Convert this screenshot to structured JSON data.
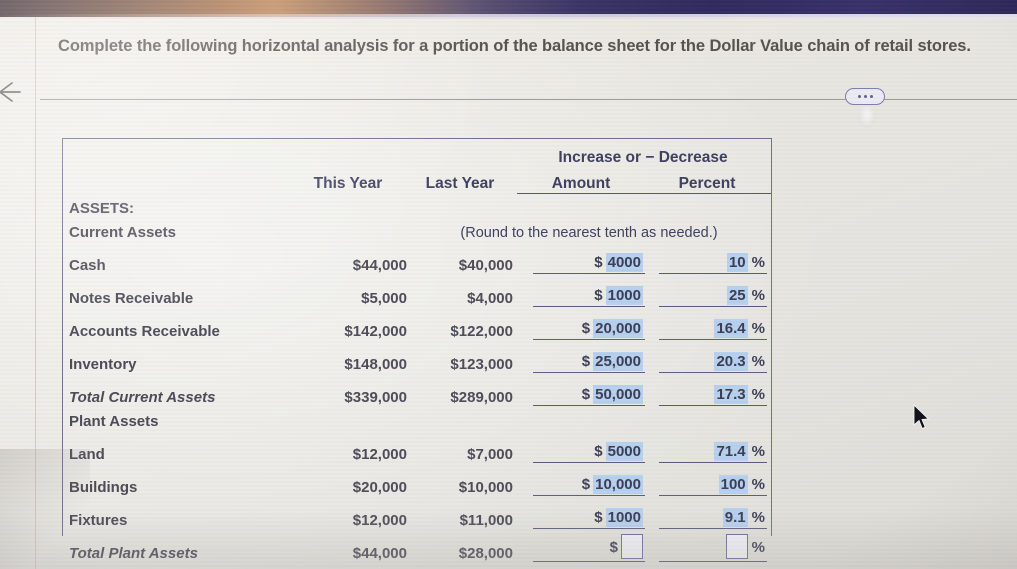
{
  "topbar": {
    "label": "browser-chrome-gradient-bar"
  },
  "nav": {
    "back_icon": "back-arrow-icon"
  },
  "prompt": {
    "text": "Complete the following horizontal analysis for a portion of the balance sheet for the Dollar Value chain of retail stores."
  },
  "divider": {
    "more_button_label": "more-options-ellipsis"
  },
  "worksheet": {
    "header": {
      "group_title": "Increase or − Decrease",
      "col_this_year": "This Year",
      "col_last_year": "Last Year",
      "col_amount": "Amount",
      "col_percent": "Percent"
    },
    "section_assets": "ASSETS:",
    "section_current_assets": "Current Assets",
    "section_plant_assets": "Plant Assets",
    "rounding_note": "(Round to the nearest tenth as needed.)",
    "rows": [
      {
        "label": "Cash",
        "this_year": "$44,000",
        "last_year": "$40,000",
        "amount_prefix": "$",
        "amount_value": "4000",
        "amount_filled": true,
        "percent_value": "10",
        "percent_suffix": "%",
        "percent_filled": true,
        "italic": false
      },
      {
        "label": "Notes Receivable",
        "this_year": "$5,000",
        "last_year": "$4,000",
        "amount_prefix": "$",
        "amount_value": "1000",
        "amount_filled": true,
        "percent_value": "25",
        "percent_suffix": "%",
        "percent_filled": true,
        "italic": false
      },
      {
        "label": "Accounts Receivable",
        "this_year": "$142,000",
        "last_year": "$122,000",
        "amount_prefix": "$",
        "amount_value": "20,000",
        "amount_filled": true,
        "percent_value": "16.4",
        "percent_suffix": "%",
        "percent_filled": true,
        "italic": false
      },
      {
        "label": "Inventory",
        "this_year": "$148,000",
        "last_year": "$123,000",
        "amount_prefix": "$",
        "amount_value": "25,000",
        "amount_filled": true,
        "percent_value": "20.3",
        "percent_suffix": "%",
        "percent_filled": true,
        "italic": false
      },
      {
        "label": "Total Current Assets",
        "this_year": "$339,000",
        "last_year": "$289,000",
        "amount_prefix": "$",
        "amount_value": "50,000",
        "amount_filled": true,
        "percent_value": "17.3",
        "percent_suffix": "%",
        "percent_filled": true,
        "italic": true
      },
      {
        "label": "Land",
        "this_year": "$12,000",
        "last_year": "$7,000",
        "amount_prefix": "$",
        "amount_value": "5000",
        "amount_filled": true,
        "percent_value": "71.4",
        "percent_suffix": "%",
        "percent_filled": true,
        "italic": false
      },
      {
        "label": "Buildings",
        "this_year": "$20,000",
        "last_year": "$10,000",
        "amount_prefix": "$",
        "amount_value": "10,000",
        "amount_filled": true,
        "percent_value": "100",
        "percent_suffix": "%",
        "percent_filled": true,
        "italic": false
      },
      {
        "label": "Fixtures",
        "this_year": "$12,000",
        "last_year": "$11,000",
        "amount_prefix": "$",
        "amount_value": "1000",
        "amount_filled": true,
        "percent_value": "9.1",
        "percent_suffix": "%",
        "percent_filled": true,
        "italic": false
      },
      {
        "label": "Total Plant Assets",
        "this_year": "$44,000",
        "last_year": "$28,000",
        "amount_prefix": "$",
        "amount_value": "",
        "amount_filled": false,
        "percent_value": "",
        "percent_suffix": "%",
        "percent_filled": false,
        "italic": true
      }
    ]
  },
  "cursor": {
    "name": "mouse-pointer"
  },
  "colors": {
    "fill_highlight": "#b7d0ef",
    "rule": "#5b5e7c",
    "text": "#4e4c58",
    "header_text": "#3a3b5c",
    "input_border": "#6d72a0",
    "page_bg": "#e8e6e0"
  }
}
